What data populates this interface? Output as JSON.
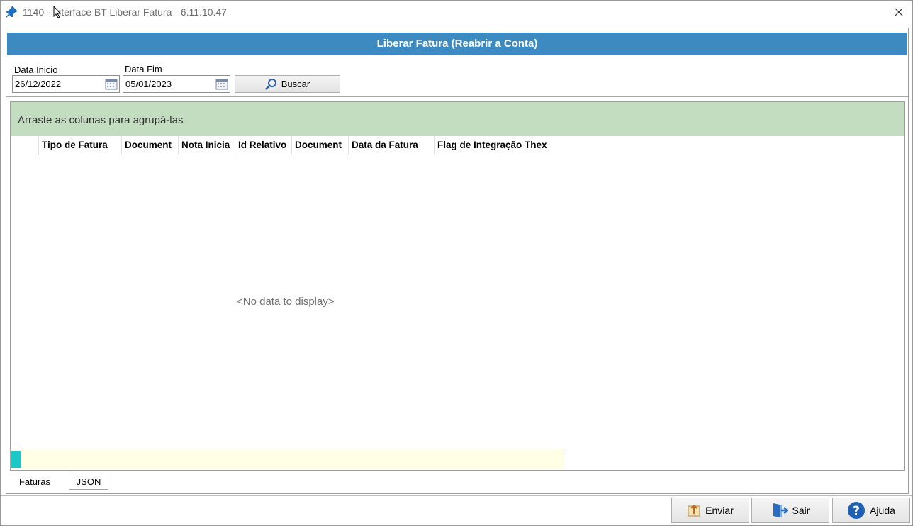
{
  "window": {
    "title": "1140 - Interface BT Liberar Fatura - 6.11.10.47"
  },
  "header": {
    "title": "Liberar Fatura (Reabrir a Conta)"
  },
  "filters": {
    "start_label": "Data Inicio",
    "start_value": "26/12/2022",
    "end_label": "Data Fim",
    "end_value": "05/01/2023",
    "search_label": "Buscar"
  },
  "grid": {
    "group_hint": "Arraste as colunas para agrupá-las",
    "columns": [
      "Tipo de Fatura",
      "Document",
      "Nota Inicia",
      "Id Relativo",
      "Document",
      "Data da Fatura",
      "Flag de Integração Thex"
    ],
    "empty_text": "<No data to display>"
  },
  "tabs": [
    "Faturas",
    "JSON"
  ],
  "footer": {
    "send_label": "Enviar",
    "exit_label": "Sair",
    "help_label": "Ajuda"
  },
  "colors": {
    "header_blue": "#3c8ac0",
    "group_green": "#c3ddc0",
    "status_cyan": "#1ec7c7"
  }
}
